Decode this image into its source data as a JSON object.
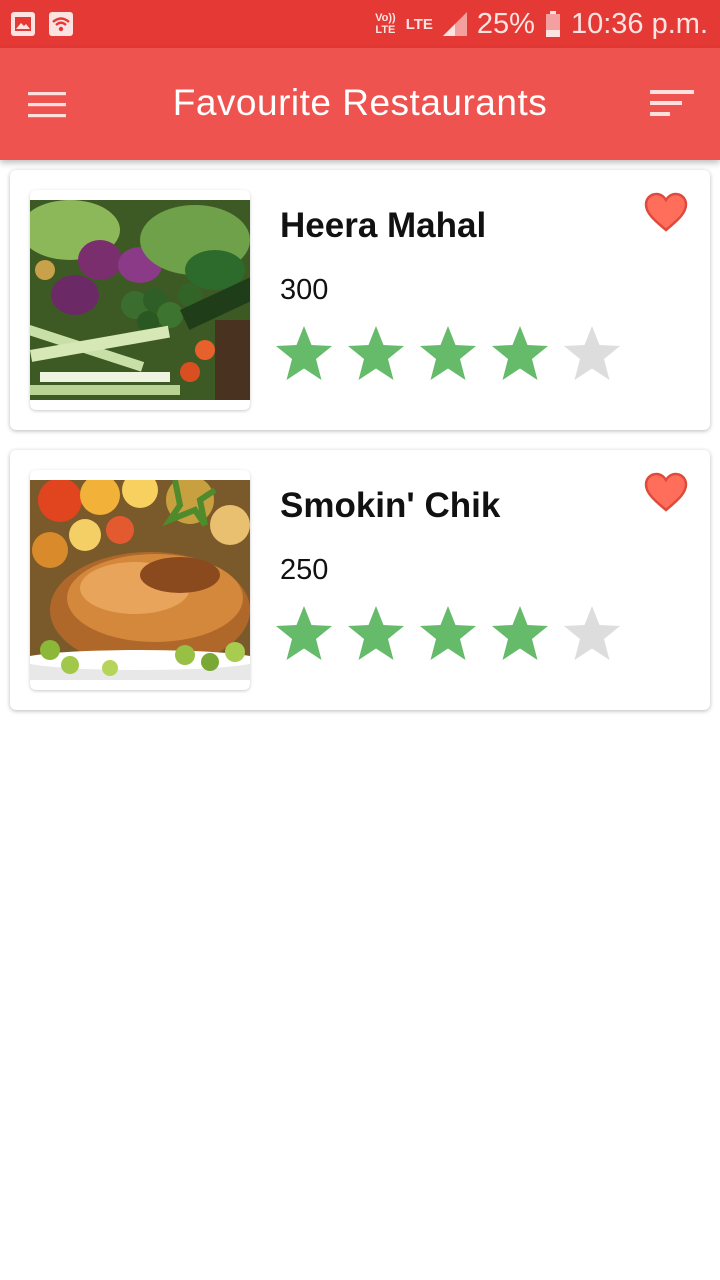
{
  "status_bar": {
    "volte_top": "Vo))",
    "volte_bottom": "LTE",
    "lte": "LTE",
    "battery": "25%",
    "time": "10:36 p.m."
  },
  "app_bar": {
    "title": "Favourite Restaurants"
  },
  "restaurants": [
    {
      "name": "Heera Mahal",
      "price": "300",
      "rating": 4,
      "max_rating": 5,
      "favourite": true,
      "image": "vegetables-photo"
    },
    {
      "name": "Smokin' Chik",
      "price": "250",
      "rating": 4,
      "max_rating": 5,
      "favourite": true,
      "image": "roast-chicken-photo"
    }
  ],
  "colors": {
    "status_bar": "#e53935",
    "app_bar": "#ef5350",
    "star_filled": "#66bb6a",
    "star_empty": "#dddddd",
    "heart": "#f05545"
  }
}
